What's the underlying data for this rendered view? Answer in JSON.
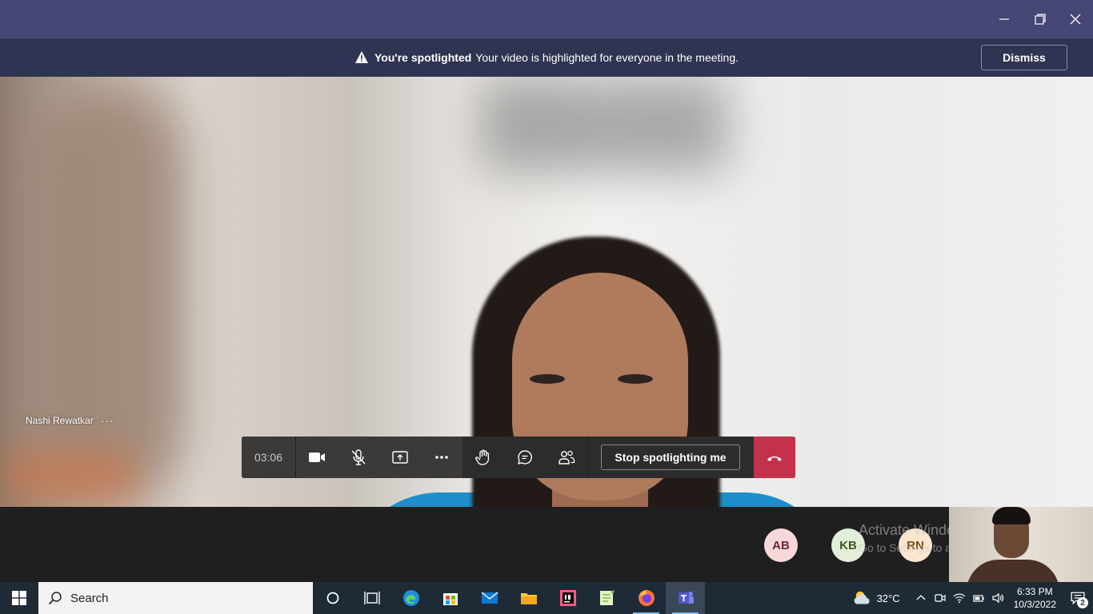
{
  "window": {
    "minimize_icon": "minimize-icon",
    "maximize_icon": "restore-icon",
    "close_icon": "close-icon"
  },
  "banner": {
    "title": "You're spotlighted",
    "message": "Your video is highlighted for everyone in the meeting.",
    "dismiss_label": "Dismiss"
  },
  "stage": {
    "participant_name": "Nashi Rewatkar",
    "participant_more": "···"
  },
  "toolbar": {
    "timer": "03:06",
    "camera_icon": "camera-icon",
    "mic_icon": "mic-off-icon",
    "share_icon": "share-screen-icon",
    "more_icon": "more-icon",
    "hand_icon": "raise-hand-icon",
    "chat_icon": "chat-icon",
    "people_icon": "participants-icon",
    "stop_spotlight_label": "Stop spotlighting me",
    "hangup_icon": "hang-up-icon",
    "hangup_color": "#c4314b"
  },
  "participants": [
    {
      "initials": "AB",
      "bg": "#f8d7da",
      "fg": "#6b2a32"
    },
    {
      "initials": "KB",
      "bg": "#e3efd9",
      "fg": "#3c5a24"
    },
    {
      "initials": "RN",
      "bg": "#fbe6cf",
      "fg": "#7a4a14"
    }
  ],
  "watermark": {
    "line1": "Activate Windows",
    "line2": "Go to Settings to activate Windo"
  },
  "taskbar": {
    "search_placeholder": "Search",
    "apps": [
      "cortana-icon",
      "task-view-icon",
      "edge-icon",
      "store-icon",
      "mail-icon",
      "file-explorer-icon",
      "intellij-icon",
      "notepad-plus-icon",
      "firefox-icon",
      "teams-icon"
    ],
    "weather": "32°C",
    "time": "6:33 PM",
    "date": "10/3/2022",
    "notifications": "2"
  },
  "colors": {
    "titlebar": "#464775",
    "banner": "#2f3452",
    "taskbar": "#1e2a35"
  }
}
